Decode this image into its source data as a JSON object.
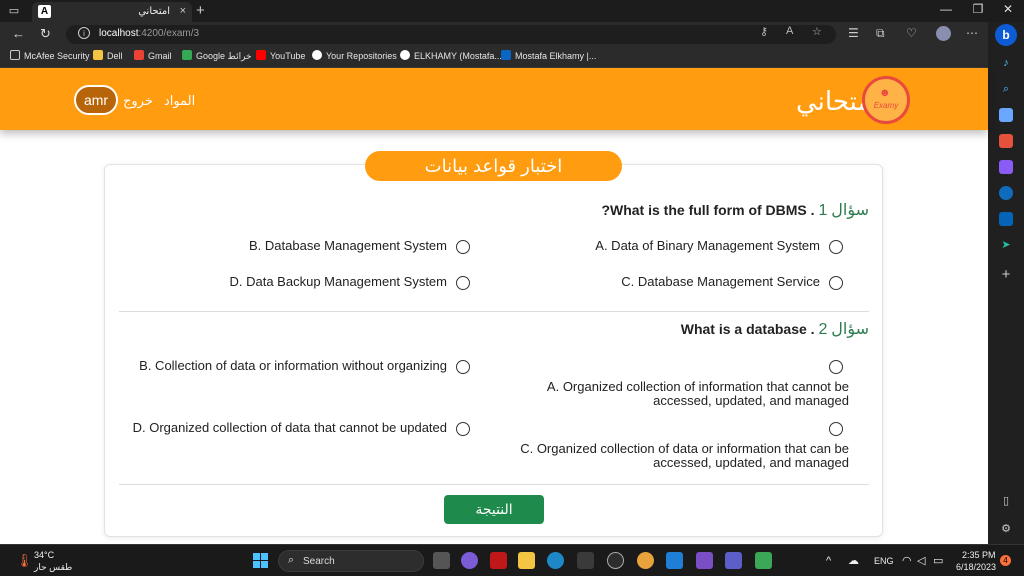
{
  "browser": {
    "tab_title": "امتحاني",
    "tab_favicon_letter": "A",
    "tab_close": "×",
    "new_tab": "+",
    "url_host": "localhost",
    "url_path": ":4200/exam/3",
    "bookmarks": [
      {
        "label": "McAfee Security",
        "icon": "page-icon",
        "color": "#cccccc"
      },
      {
        "label": "Dell",
        "icon": "folder-icon",
        "color": "#f4c542"
      },
      {
        "label": "Gmail",
        "icon": "gmail-icon",
        "color": "#ea4335"
      },
      {
        "label": "Google خرائط",
        "icon": "maps-icon",
        "color": "#34a853"
      },
      {
        "label": "YouTube",
        "icon": "youtube-icon",
        "color": "#ff0000"
      },
      {
        "label": "Your Repositories",
        "icon": "github-icon",
        "color": "#ffffff"
      },
      {
        "label": "ELKHAMY (Mostafa...",
        "icon": "github-icon",
        "color": "#ffffff"
      },
      {
        "label": "Mostafa Elkhamy |...",
        "icon": "linkedin-icon",
        "color": "#0a66c2"
      }
    ]
  },
  "header": {
    "user": "amr",
    "nav_logout": "خروج",
    "nav_subjects": "المواد",
    "brand": "امتحاني",
    "logo_text": "Examy"
  },
  "exam": {
    "title": "اختبار قواعد بيانات",
    "questions": [
      {
        "label": "سؤال",
        "number": "1",
        "text": "?What is the full form of DBMS .",
        "options": [
          "A. Data of Binary Management System",
          "B. Database Management System",
          "C. Database Management Service",
          "D. Data Backup Management System"
        ]
      },
      {
        "label": "سؤال",
        "number": "2",
        "text": "What is a database .",
        "options": [
          "A. Organized collection of information that cannot be accessed, updated, and managed",
          "B. Collection of data or information without organizing",
          "C. Organized collection of data or information that can be accessed, updated, and managed",
          "D. Organized collection of data that cannot be updated"
        ]
      }
    ],
    "result_button": "النتيجة"
  },
  "taskbar": {
    "temperature": "34°C",
    "weather": "طقس حار",
    "search_placeholder": "Search",
    "language": "ENG",
    "time": "2:35 PM",
    "date": "6/18/2023",
    "notifications": "4"
  },
  "colors": {
    "accent_orange": "#ff9c0f",
    "question_number_green": "#2e7d4f",
    "result_button_green": "#1e8a4c"
  }
}
